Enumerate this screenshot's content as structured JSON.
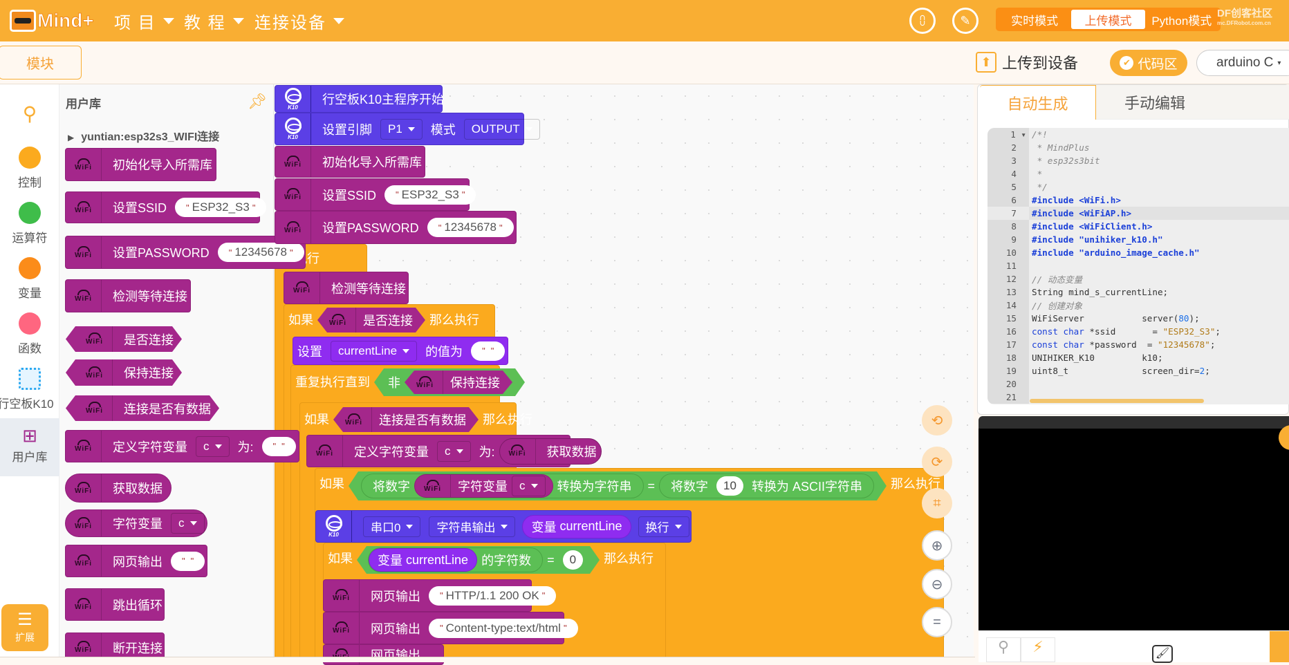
{
  "topbar": {
    "app_name": "Mind+",
    "menus": [
      "项 目",
      "教 程",
      "连接设备"
    ],
    "modes": [
      "实时模式",
      "上传模式",
      "Python模式"
    ],
    "active_mode": "上传模式",
    "watermark": "DF创客社区",
    "watermark_url": "mc.DFRobot.com.cn"
  },
  "secbar": {
    "blocks_tab": "模块",
    "upload_label": "上传到设备",
    "code_button": "代码区",
    "language": "arduino C"
  },
  "categories": [
    {
      "label": "控制",
      "color": "#fbaa1e"
    },
    {
      "label": "运算符",
      "color": "#3fbd4a"
    },
    {
      "label": "变量",
      "color": "#fb8c1a"
    },
    {
      "label": "函数",
      "color": "#ff6680"
    },
    {
      "label": "行空板K10",
      "color": "#2ba8f0"
    },
    {
      "label": "用户库",
      "color": "#a12a8e",
      "selected": true
    }
  ],
  "extend_label": "扩展",
  "flyout": {
    "title": "用户库",
    "group": "yuntian:esp32s3_WIFI连接",
    "b": {
      "init": "初始化导入所需库",
      "ssid": "设置SSID",
      "ssid_val": "ESP32_S3",
      "pwd": "设置PASSWORD",
      "pwd_val": "12345678",
      "wait": "检测等待连接",
      "isconn": "是否连接",
      "keep": "保持连接",
      "hasdata": "连接是否有数据",
      "defvar": "定义字符变量",
      "var_c": "c",
      "as": "为:",
      "empty": "",
      "getdata": "获取数据",
      "charvar": "字符变量",
      "webout": "网页输出",
      "break": "跳出循环",
      "disconnect": "断开连接"
    }
  },
  "workspace": {
    "main": "行空板K10主程序开始",
    "setpin": "设置引脚",
    "pin": "P1",
    "mode": "模式",
    "mode_val": "OUTPUT",
    "exec": "执行",
    "if": "如果",
    "then": "那么执行",
    "set": "设置",
    "currentLine": "currentLine",
    "value_is": "的值为",
    "repeat_until": "重复执行直到",
    "not": "非",
    "to_num": "将数字",
    "to_str": "转换为字符串",
    "eq": "=",
    "ten": "10",
    "to_ascii": "转换为 ASCII字符串",
    "serial": "串口0",
    "str_out": "字符串输出",
    "var_label": "变量",
    "newline": "换行",
    "char_count": "的字符数",
    "zero": "0",
    "http": "HTTP/1.1 200 OK",
    "content_type": "Content-type:text/html"
  },
  "tools": [
    "undo-icon",
    "redo-icon",
    "crop-icon",
    "zoom-in-icon",
    "zoom-out-icon",
    "reset-zoom-icon"
  ],
  "code_panel": {
    "tabs": [
      "自动生成",
      "手动编辑"
    ],
    "active_tab": "自动生成",
    "current_line": 7,
    "lines": [
      [
        [
          "/*!",
          "comment"
        ]
      ],
      [
        [
          " * MindPlus",
          "comment"
        ]
      ],
      [
        [
          " * esp32s3bit",
          "comment"
        ]
      ],
      [
        [
          " *",
          "comment"
        ]
      ],
      [
        [
          " */",
          "comment"
        ]
      ],
      [
        [
          "#include ",
          "inc"
        ],
        [
          "<WiFi.h>",
          "inc"
        ]
      ],
      [
        [
          "#include ",
          "inc"
        ],
        [
          "<WiFiAP.h>",
          "inc"
        ]
      ],
      [
        [
          "#include ",
          "inc"
        ],
        [
          "<WiFiClient.h>",
          "inc"
        ]
      ],
      [
        [
          "#include ",
          "inc"
        ],
        [
          "\"unihiker_k10.h\"",
          "inc"
        ]
      ],
      [
        [
          "#include ",
          "inc"
        ],
        [
          "\"arduino_image_cache.h\"",
          "inc"
        ]
      ],
      [],
      [
        [
          "// 动态变量",
          "comment"
        ]
      ],
      [
        [
          "String mind_s_currentLine;",
          "plain"
        ]
      ],
      [
        [
          "// 创建对象",
          "comment"
        ]
      ],
      [
        [
          "WiFiServer           server(",
          "plain"
        ],
        [
          "80",
          "num"
        ],
        [
          ");",
          "plain"
        ]
      ],
      [
        [
          "const ",
          "kw"
        ],
        [
          "char ",
          "kw"
        ],
        [
          "*ssid       = ",
          "plain"
        ],
        [
          "\"ESP32_S3\"",
          "str"
        ],
        [
          ";",
          "plain"
        ]
      ],
      [
        [
          "const ",
          "kw"
        ],
        [
          "char ",
          "kw"
        ],
        [
          "*password  = ",
          "plain"
        ],
        [
          "\"12345678\"",
          "str"
        ],
        [
          ";",
          "plain"
        ]
      ],
      [
        [
          "UNIHIKER_K10         k10;",
          "plain"
        ]
      ],
      [
        [
          "uint8_t              screen_dir=",
          "plain"
        ],
        [
          "2",
          "num"
        ],
        [
          ";",
          "plain"
        ]
      ],
      [],
      []
    ]
  },
  "colors": {
    "brand": "#f9ae33",
    "wifi_block": "#a4278b",
    "k10_block": "#5b3fe6",
    "control_block": "#fbaa1e",
    "operator_block": "#5cbf55",
    "variable_block": "#8f2cf0"
  }
}
